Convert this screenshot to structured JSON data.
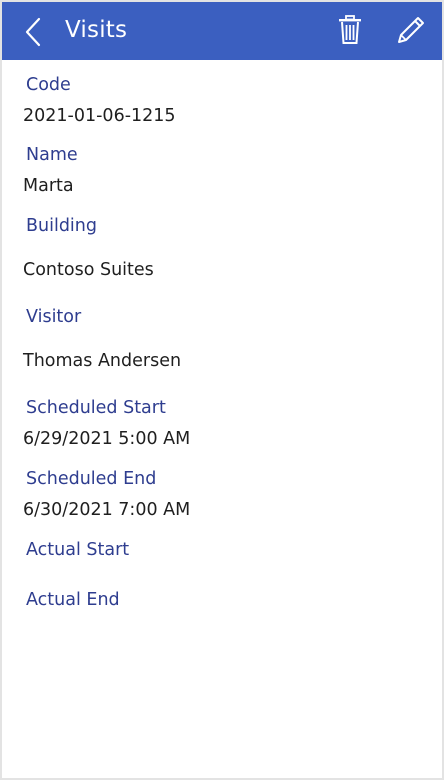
{
  "header": {
    "title": "Visits",
    "background_color": "#3b5fc0",
    "icons": {
      "back": "chevron-left-icon",
      "delete": "trash-icon",
      "edit": "pencil-icon"
    }
  },
  "fields": {
    "code": {
      "label": "Code",
      "value": "2021-01-06-1215"
    },
    "name": {
      "label": "Name",
      "value": "Marta"
    },
    "building": {
      "label": "Building",
      "value": "Contoso Suites"
    },
    "visitor": {
      "label": "Visitor",
      "value": "Thomas Andersen"
    },
    "scheduled_start": {
      "label": "Scheduled Start",
      "value": "6/29/2021 5:00 AM"
    },
    "scheduled_end": {
      "label": "Scheduled End",
      "value": "6/30/2021 7:00 AM"
    },
    "actual_start": {
      "label": "Actual Start",
      "value": ""
    },
    "actual_end": {
      "label": "Actual End",
      "value": ""
    }
  },
  "colors": {
    "label": "#2e3d8f",
    "value": "#1f1f1f",
    "header_text": "#ffffff"
  }
}
